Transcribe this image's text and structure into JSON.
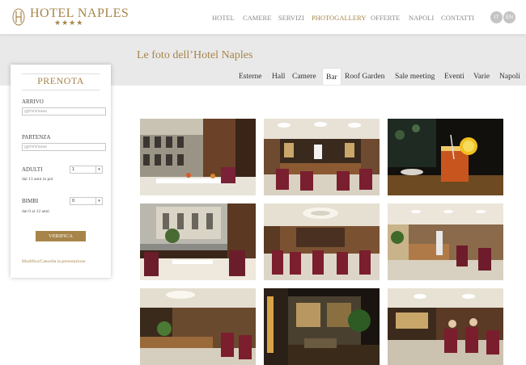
{
  "header": {
    "logo_name": "HOTEL NAPLES",
    "logo_stars": "★★★★",
    "nav": [
      {
        "label": "HOTEL",
        "active": false
      },
      {
        "label": "CAMERE",
        "active": false
      },
      {
        "label": "SERVIZI",
        "active": false
      },
      {
        "label": "PHOTOGALLERY",
        "active": true
      },
      {
        "label": "OFFERTE",
        "active": false
      },
      {
        "label": "NAPOLI",
        "active": false
      },
      {
        "label": "CONTATTI",
        "active": false
      }
    ],
    "languages": [
      "IT",
      "EN"
    ]
  },
  "page": {
    "title": "Le foto dell’Hotel Naples",
    "tabs": [
      {
        "label": "Esterne",
        "active": false
      },
      {
        "label": "Hall",
        "active": false
      },
      {
        "label": "Camere",
        "active": false
      },
      {
        "label": "Bar",
        "active": true
      },
      {
        "label": "Roof Garden",
        "active": false
      },
      {
        "label": "Sale meeting",
        "active": false
      },
      {
        "label": "Eventi",
        "active": false
      },
      {
        "label": "Varie",
        "active": false
      },
      {
        "label": "Napoli",
        "active": false
      }
    ]
  },
  "booking": {
    "title": "PRENOTA",
    "arrivo_label": "ARRIVO",
    "arrivo_placeholder": "gg/mm/aaaa",
    "partenza_label": "PARTENZA",
    "partenza_placeholder": "gg/mm/aaaa",
    "adulti_label": "ADULTI",
    "adulti_value": "1",
    "adulti_note": "dai 13 anni in poi",
    "bimbi_label": "BIMBI",
    "bimbi_value": "0",
    "bimbi_note": "dai 0 ai 12 anni",
    "verifica_label": "VERIFICA",
    "modifica_link": "Modifica/Cancella la prenotazione"
  },
  "gallery": {
    "photos": [
      "window-view-dining",
      "bar-counter-bartender",
      "cocktail-drink",
      "window-street-view",
      "bar-seating-lounge",
      "bar-counter-lounge",
      "bar-ceiling-chandelier",
      "bar-night-window",
      "bar-lounge-guests"
    ]
  },
  "colors": {
    "accent": "#a7844a",
    "nav_text": "#8a8a8a",
    "band": "#e9e9e9"
  }
}
